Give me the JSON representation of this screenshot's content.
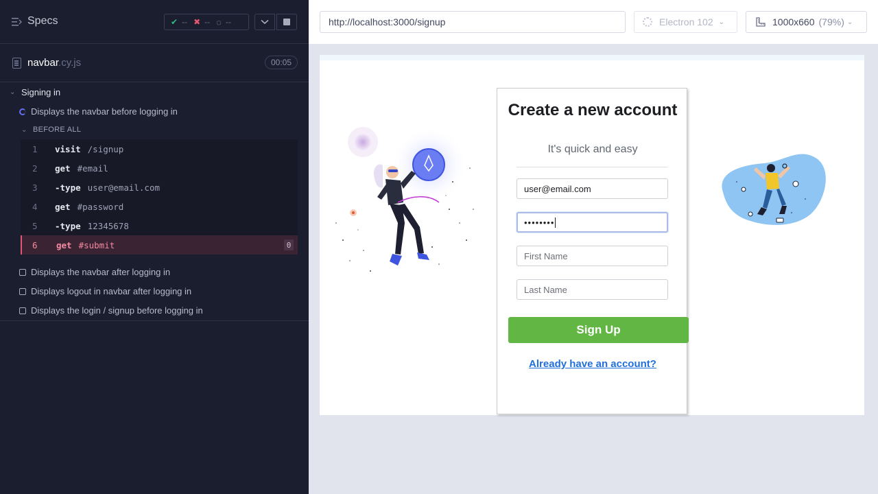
{
  "sidebar": {
    "title": "Specs",
    "stats": {
      "passed": "--",
      "failed": "--",
      "pending": "--"
    },
    "file": {
      "name": "navbar",
      "ext": ".cy.js",
      "duration": "00:05"
    },
    "suite": {
      "title": "Signing in",
      "tests": [
        "Displays the navbar before logging in",
        "Displays the navbar after logging in",
        "Displays logout in navbar after logging in",
        "Displays the login / signup before logging in"
      ],
      "hook_title": "BEFORE ALL",
      "commands": [
        {
          "num": "1",
          "name": "visit",
          "msg": "/signup"
        },
        {
          "num": "2",
          "name": "get",
          "msg": "#email"
        },
        {
          "num": "3",
          "name": "-type",
          "msg": "user@email.com"
        },
        {
          "num": "4",
          "name": "get",
          "msg": "#password"
        },
        {
          "num": "5",
          "name": "-type",
          "msg": "12345678"
        },
        {
          "num": "6",
          "name": "get",
          "msg": "#submit",
          "count": "0"
        }
      ]
    }
  },
  "toolbar": {
    "url": "http://localhost:3000/signup",
    "browser": "Electron 102",
    "viewport": "1000x660",
    "scale": "(79%)"
  },
  "app": {
    "title": "Create a new account",
    "subtitle": "It's quick and easy",
    "email_value": "user@email.com",
    "password_mask": "••••••••",
    "first_name_placeholder": "First Name",
    "last_name_placeholder": "Last Name",
    "signup_label": "Sign Up",
    "login_link": "Already have an account?"
  },
  "colors": {
    "sidebar_bg": "#1b1e2e",
    "pass": "#2fbd8b",
    "fail": "#e45770",
    "signup_button": "#62b744",
    "link": "#216fdb"
  },
  "icons": [
    "menu-lines-icon",
    "check-icon",
    "x-icon",
    "spinner-icon",
    "chevron-down-icon",
    "stop-icon",
    "file-icon",
    "gear-icon",
    "ruler-icon"
  ]
}
